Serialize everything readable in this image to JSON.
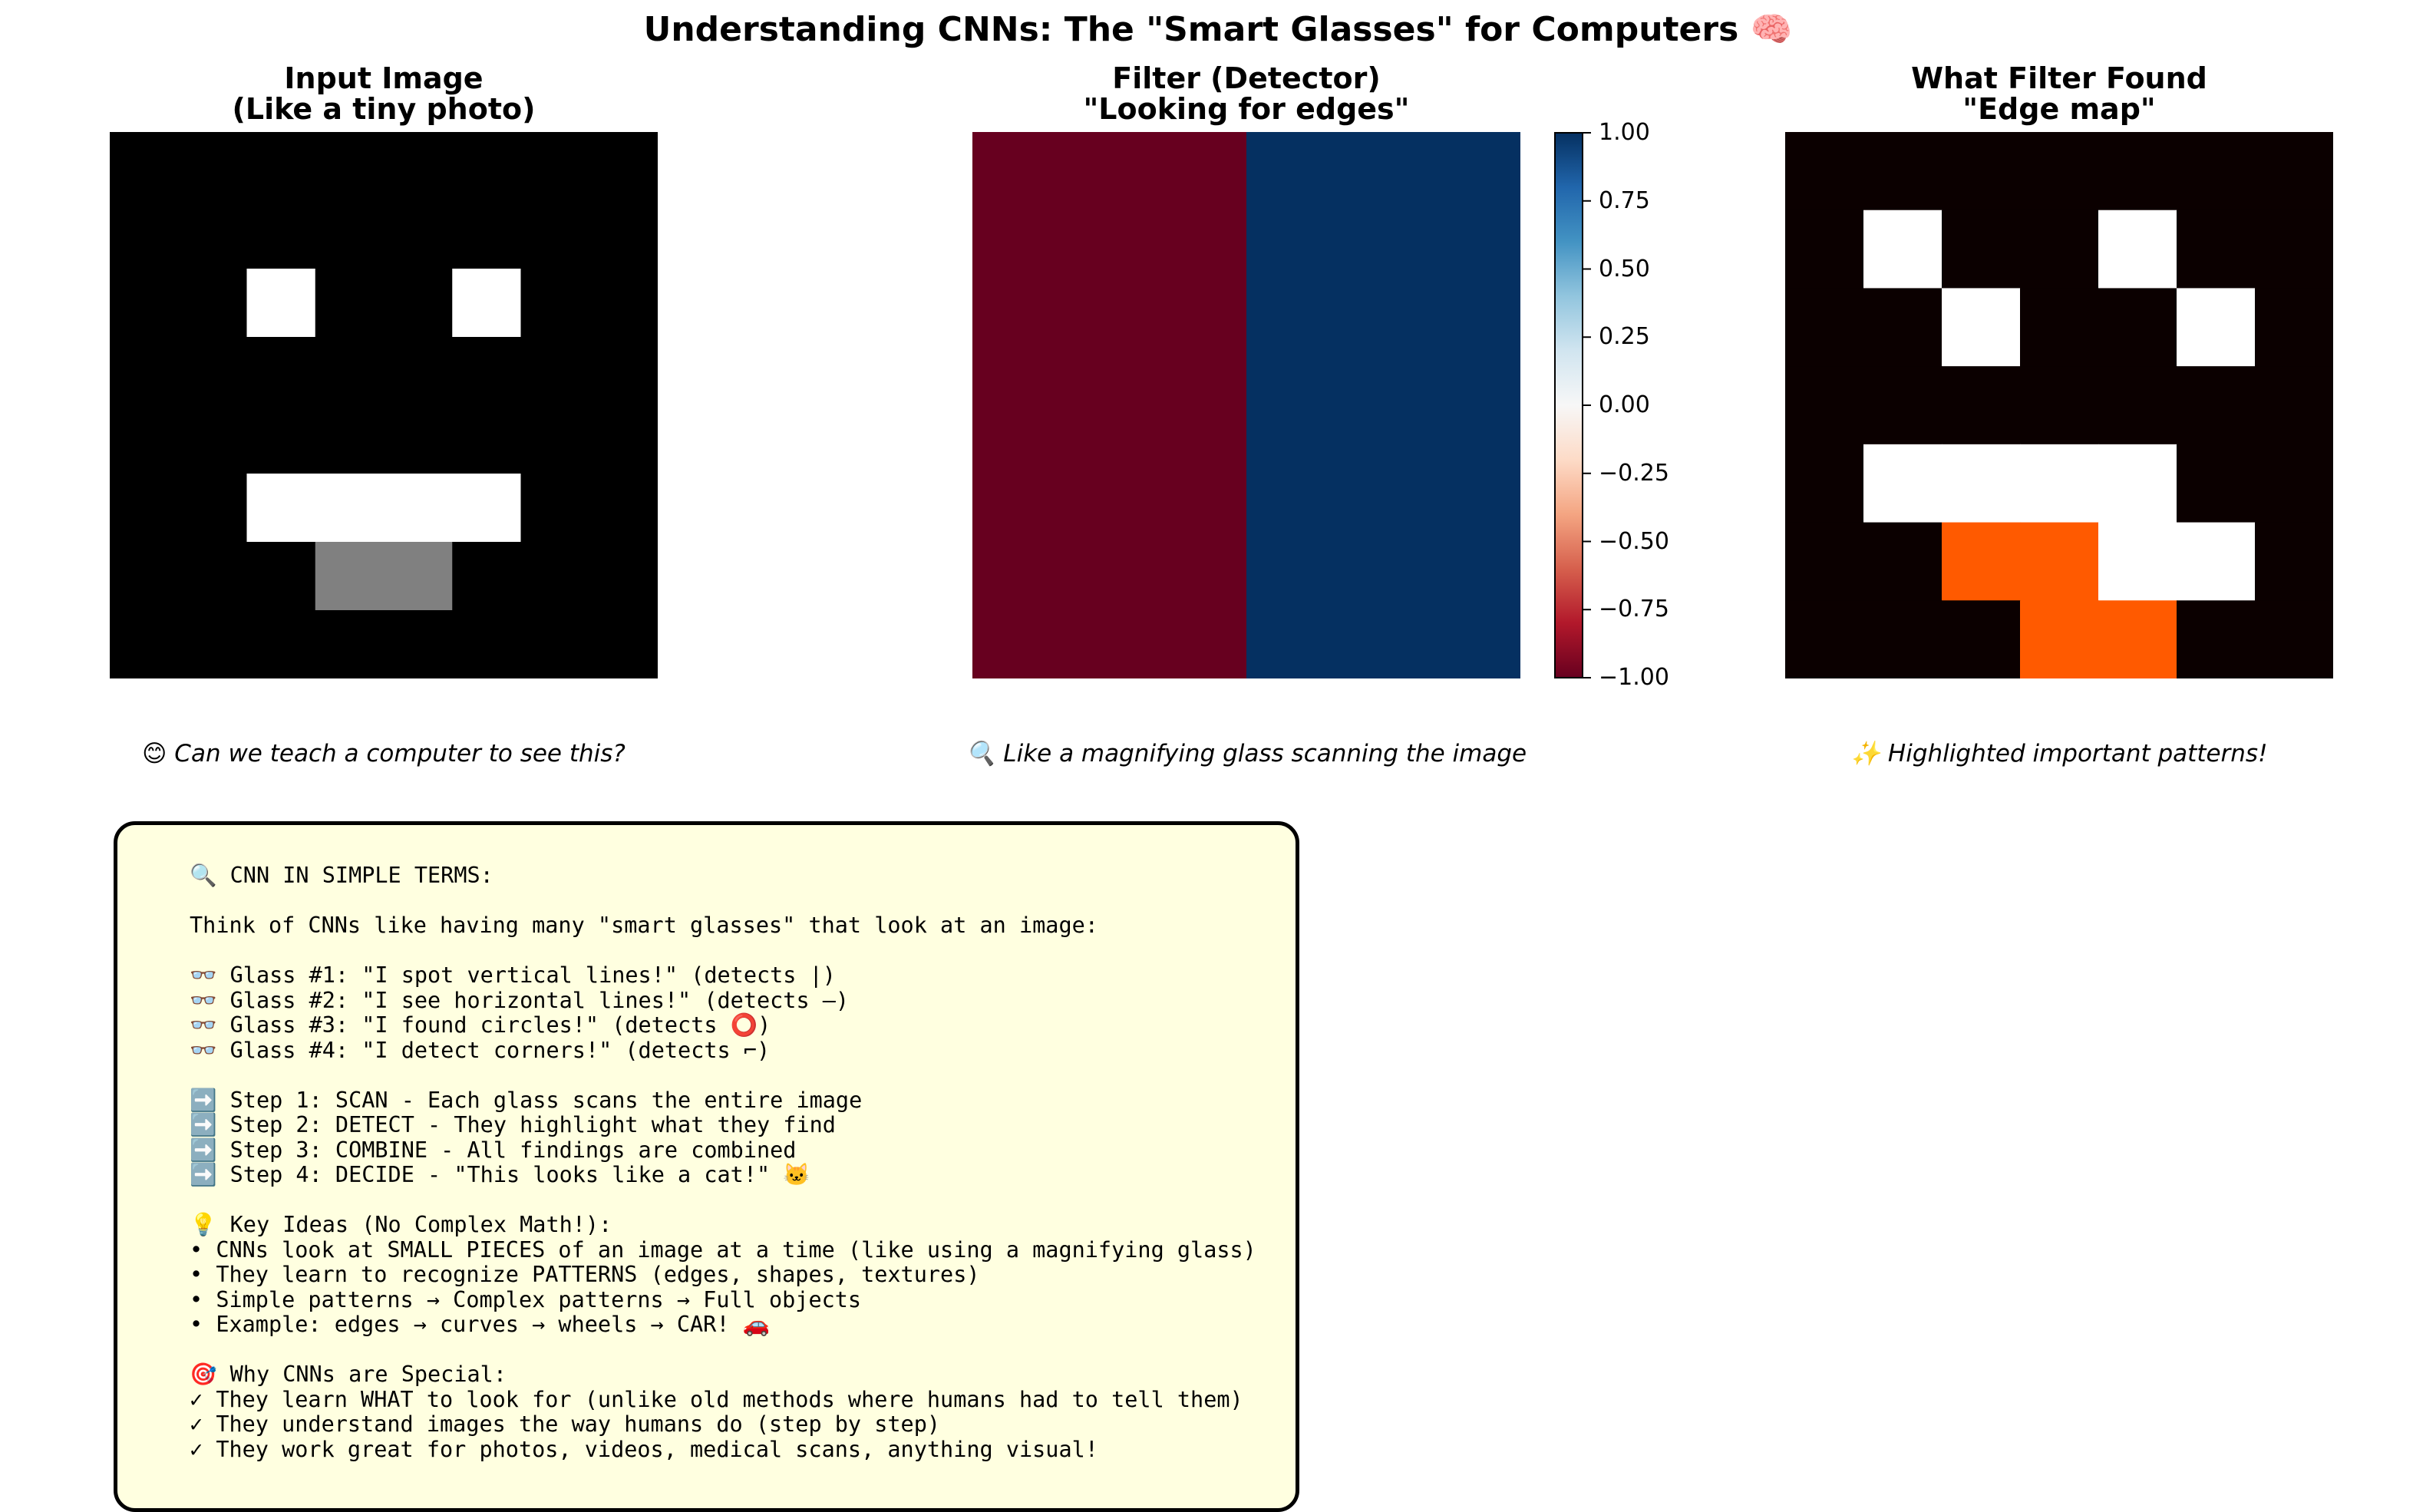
{
  "figure": {
    "title": "Understanding CNNs: The \"Smart Glasses\" for Computers 🧠"
  },
  "chart_data": [
    {
      "type": "heatmap",
      "title": "Input Image\n(Like a tiny photo)",
      "caption": "😊 Can we teach a computer to see this?",
      "colormap": "gray",
      "vmin": 0,
      "vmax": 1,
      "grid": false,
      "values": [
        [
          0,
          0,
          0,
          0,
          0,
          0,
          0,
          0
        ],
        [
          0,
          0,
          0,
          0,
          0,
          0,
          0,
          0
        ],
        [
          0,
          0,
          1,
          0,
          0,
          1,
          0,
          0
        ],
        [
          0,
          0,
          0,
          0,
          0,
          0,
          0,
          0
        ],
        [
          0,
          0,
          0,
          0,
          0,
          0,
          0,
          0
        ],
        [
          0,
          0,
          1,
          1,
          1,
          1,
          0,
          0
        ],
        [
          0,
          0,
          0,
          0.5,
          0.5,
          0,
          0,
          0
        ],
        [
          0,
          0,
          0,
          0,
          0,
          0,
          0,
          0
        ]
      ]
    },
    {
      "type": "heatmap",
      "title": "Filter (Detector)\n\"Looking for edges\"",
      "caption": "🔍 Like a magnifying glass scanning the image",
      "colormap": "RdBu",
      "vmin": -1,
      "vmax": 1,
      "grid": false,
      "values": [
        [
          -1,
          1
        ],
        [
          -1,
          1
        ]
      ],
      "colorbar": {
        "ticks": [
          "1.00",
          "0.75",
          "0.50",
          "0.25",
          "0.00",
          "−0.25",
          "−0.50",
          "−0.75",
          "−1.00"
        ]
      }
    },
    {
      "type": "heatmap",
      "title": "What Filter Found\n\"Edge map\"",
      "caption": "✨ Highlighted important patterns!",
      "colormap": "hot",
      "vmin": 0,
      "vmax": 2,
      "grid": false,
      "values": [
        [
          0,
          0,
          0,
          0,
          0,
          0,
          0
        ],
        [
          0,
          2,
          0,
          0,
          2,
          0,
          0
        ],
        [
          0,
          0,
          2,
          0,
          0,
          2,
          0
        ],
        [
          0,
          0,
          0,
          0,
          0,
          0,
          0
        ],
        [
          0,
          2,
          2,
          2,
          2,
          0,
          0
        ],
        [
          0,
          0,
          1,
          1,
          2,
          2,
          0
        ],
        [
          0,
          0,
          0,
          1,
          1,
          0,
          0
        ]
      ]
    }
  ],
  "info_box": {
    "text": "🔍 CNN IN SIMPLE TERMS:\n\nThink of CNNs like having many \"smart glasses\" that look at an image:\n\n👓 Glass #1: \"I spot vertical lines!\" (detects |)\n👓 Glass #2: \"I see horizontal lines!\" (detects —)\n👓 Glass #3: \"I found circles!\" (detects ⭕)\n👓 Glass #4: \"I detect corners!\" (detects ⌐)\n\n➡️ Step 1: SCAN - Each glass scans the entire image\n➡️ Step 2: DETECT - They highlight what they find\n➡️ Step 3: COMBINE - All findings are combined\n➡️ Step 4: DECIDE - \"This looks like a cat!\" 🐱\n\n💡 Key Ideas (No Complex Math!):\n• CNNs look at SMALL PIECES of an image at a time (like using a magnifying glass)\n• They learn to recognize PATTERNS (edges, shapes, textures)\n• Simple patterns → Complex patterns → Full objects\n• Example: edges → curves → wheels → CAR! 🚗\n\n🎯 Why CNNs are Special:\n✓ They learn WHAT to look for (unlike old methods where humans had to tell them)\n✓ They understand images the way humans do (step by step)\n✓ They work great for photos, videos, medical scans, anything visual!",
    "background": "#ffffe0",
    "border": "#000000"
  }
}
